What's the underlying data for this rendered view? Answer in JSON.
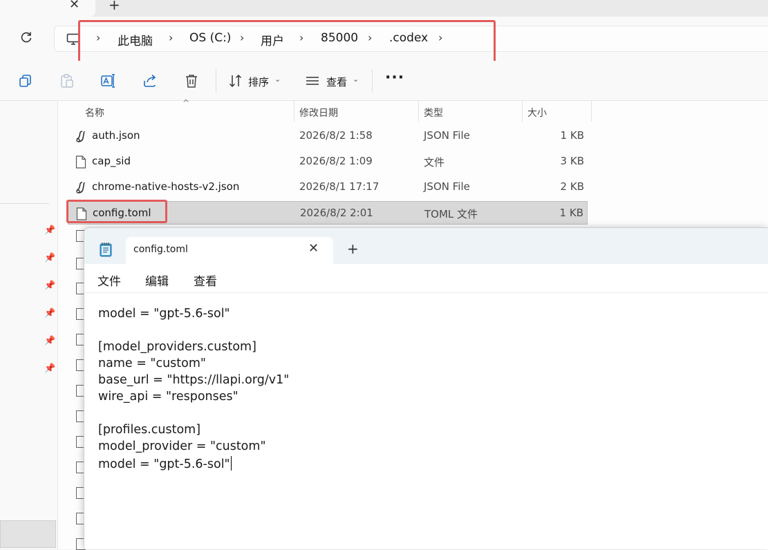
{
  "window": {
    "tab_close_glyph": "✕",
    "tab_add_glyph": "+"
  },
  "address_bar": {
    "refresh_icon": "refresh-icon",
    "location_icon": "this-pc-icon",
    "breadcrumb": [
      "此电脑",
      "OS (C:)",
      "用户",
      "85000",
      ".codex"
    ],
    "separator_glyph": "›"
  },
  "toolbar": {
    "items": [
      "copy-icon",
      "paste-icon",
      "rename-icon",
      "share-icon",
      "delete-icon"
    ],
    "sort_label": "排序",
    "view_label": "查看",
    "caret_glyph": "⌄",
    "more_glyph": "···"
  },
  "file_list": {
    "columns": {
      "name": "名称",
      "modified": "修改日期",
      "type": "类型",
      "size": "大小"
    },
    "sort_caret": "^",
    "rows": [
      {
        "icon": "json-file-icon",
        "name": "auth.json",
        "modified": "2026/8/2 1:58",
        "type": "JSON File",
        "size": "1 KB"
      },
      {
        "icon": "blank-file-icon",
        "name": "cap_sid",
        "modified": "2026/8/2 1:09",
        "type": "文件",
        "size": "3 KB"
      },
      {
        "icon": "json-file-icon",
        "name": "chrome-native-hosts-v2.json",
        "modified": "2026/8/1 17:17",
        "type": "JSON File",
        "size": "2 KB"
      },
      {
        "icon": "blank-file-icon",
        "name": "config.toml",
        "modified": "2026/8/2 2:01",
        "type": "TOML 文件",
        "size": "1 KB",
        "selected": true
      }
    ]
  },
  "nav_pane": {
    "pin_glyph": "📌"
  },
  "notepad": {
    "tab_title": "config.toml",
    "tab_close_glyph": "✕",
    "tab_add_glyph": "+",
    "menu": [
      "文件",
      "编辑",
      "查看"
    ],
    "lines": [
      "model = \"gpt-5.6-sol\"",
      "",
      "[model_providers.custom]",
      "name = \"custom\"",
      "base_url = \"https://llapi.org/v1\"",
      "wire_api = \"responses\"",
      "",
      "[profiles.custom]",
      "model_provider = \"custom\"",
      "model = \"gpt-5.6-sol\""
    ]
  },
  "colors": {
    "highlight_box": "#e45a5a",
    "selection": "#d8d8d8"
  }
}
